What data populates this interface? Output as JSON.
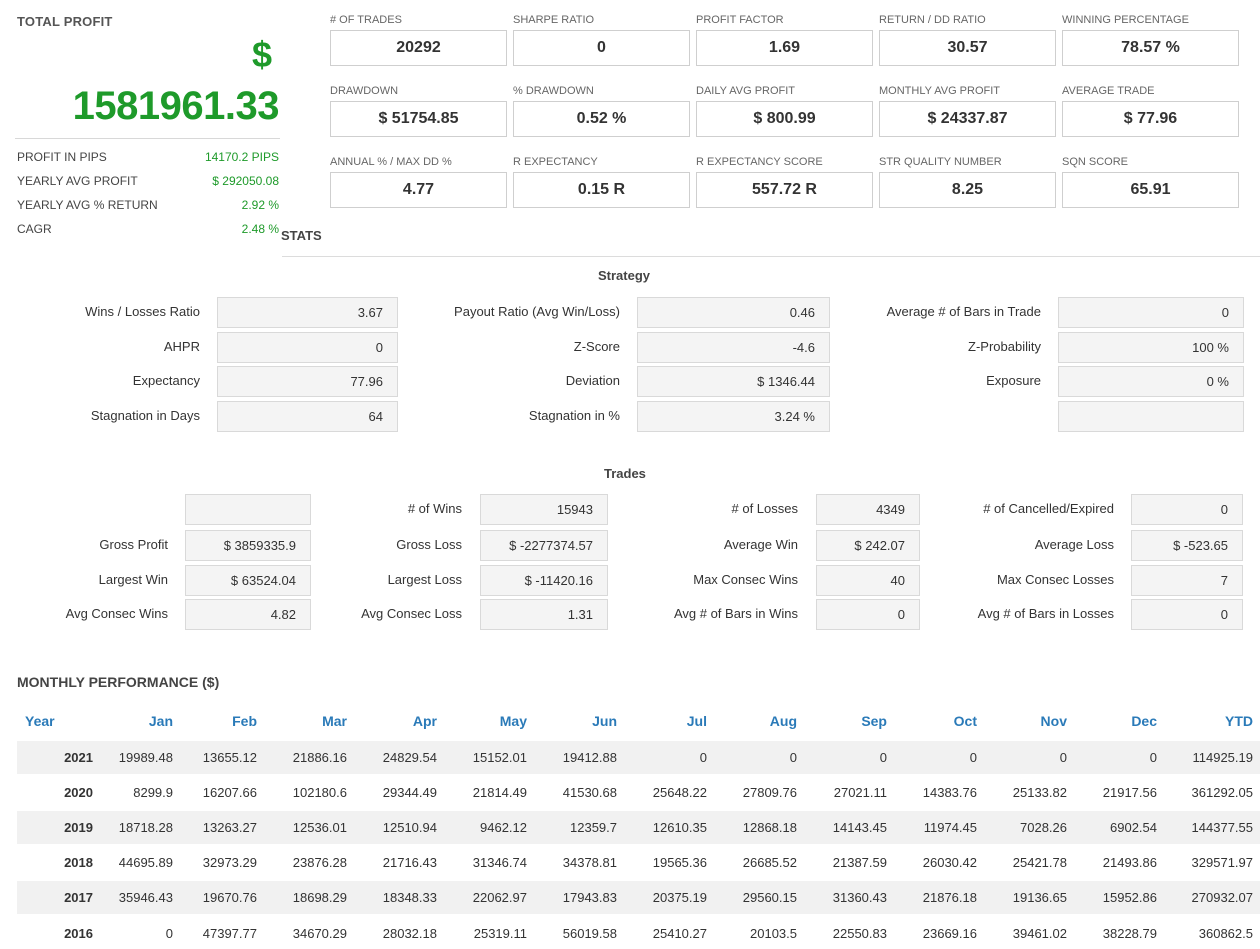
{
  "total_profit": {
    "title": "TOTAL PROFIT",
    "currency": "$",
    "value": "1581961.33",
    "stats": [
      {
        "label": "PROFIT IN PIPS",
        "value": "14170.2 PIPS"
      },
      {
        "label": "YEARLY AVG PROFIT",
        "value": "$ 292050.08"
      },
      {
        "label": "YEARLY AVG % RETURN",
        "value": "2.92 %"
      },
      {
        "label": "CAGR",
        "value": "2.48 %"
      }
    ]
  },
  "kpis": [
    {
      "label": "# OF TRADES",
      "value": "20292"
    },
    {
      "label": "SHARPE RATIO",
      "value": "0"
    },
    {
      "label": "PROFIT FACTOR",
      "value": "1.69"
    },
    {
      "label": "RETURN / DD RATIO",
      "value": "30.57"
    },
    {
      "label": "WINNING PERCENTAGE",
      "value": "78.57 %"
    },
    {
      "label": "DRAWDOWN",
      "value": "$ 51754.85"
    },
    {
      "label": "% DRAWDOWN",
      "value": "0.52 %"
    },
    {
      "label": "DAILY AVG PROFIT",
      "value": "$ 800.99"
    },
    {
      "label": "MONTHLY AVG PROFIT",
      "value": "$ 24337.87"
    },
    {
      "label": "AVERAGE TRADE",
      "value": "$ 77.96"
    },
    {
      "label": "ANNUAL % / MAX DD %",
      "value": "4.77"
    },
    {
      "label": "R EXPECTANCY",
      "value": "0.15 R"
    },
    {
      "label": "R EXPECTANCY SCORE",
      "value": "557.72 R"
    },
    {
      "label": "STR QUALITY NUMBER",
      "value": "8.25"
    },
    {
      "label": "SQN SCORE",
      "value": "65.91"
    }
  ],
  "stats_title": "STATS",
  "strategy": {
    "title": "Strategy",
    "rows": [
      [
        {
          "label": "Wins / Losses Ratio",
          "value": "3.67"
        },
        {
          "label": "Payout Ratio (Avg Win/Loss)",
          "value": "0.46"
        },
        {
          "label": "Average # of Bars in Trade",
          "value": "0"
        }
      ],
      [
        {
          "label": "AHPR",
          "value": "0"
        },
        {
          "label": "Z-Score",
          "value": "-4.6"
        },
        {
          "label": "Z-Probability",
          "value": "100 %"
        }
      ],
      [
        {
          "label": "Expectancy",
          "value": "77.96"
        },
        {
          "label": "Deviation",
          "value": "$ 1346.44"
        },
        {
          "label": "Exposure",
          "value": "0 %"
        }
      ],
      [
        {
          "label": "Stagnation in Days",
          "value": "64"
        },
        {
          "label": "Stagnation in %",
          "value": "3.24 %"
        },
        {
          "label": "",
          "value": ""
        }
      ]
    ]
  },
  "trades": {
    "title": "Trades",
    "rows": [
      [
        {
          "label": "",
          "value": ""
        },
        {
          "label": "# of Wins",
          "value": "15943"
        },
        {
          "label": "# of Losses",
          "value": "4349"
        },
        {
          "label": "# of Cancelled/Expired",
          "value": "0"
        }
      ],
      [
        {
          "label": "Gross Profit",
          "value": "$ 3859335.9"
        },
        {
          "label": "Gross Loss",
          "value": "$ -2277374.57"
        },
        {
          "label": "Average Win",
          "value": "$ 242.07"
        },
        {
          "label": "Average Loss",
          "value": "$ -523.65"
        }
      ],
      [
        {
          "label": "Largest Win",
          "value": "$ 63524.04"
        },
        {
          "label": "Largest Loss",
          "value": "$ -11420.16"
        },
        {
          "label": "Max Consec Wins",
          "value": "40"
        },
        {
          "label": "Max Consec Losses",
          "value": "7"
        }
      ],
      [
        {
          "label": "Avg Consec Wins",
          "value": "4.82"
        },
        {
          "label": "Avg Consec Loss",
          "value": "1.31"
        },
        {
          "label": "Avg # of Bars in Wins",
          "value": "0"
        },
        {
          "label": "Avg # of Bars in Losses",
          "value": "0"
        }
      ]
    ]
  },
  "monthly": {
    "title": "MONTHLY PERFORMANCE ($)",
    "headers": [
      "Year",
      "Jan",
      "Feb",
      "Mar",
      "Apr",
      "May",
      "Jun",
      "Jul",
      "Aug",
      "Sep",
      "Oct",
      "Nov",
      "Dec",
      "YTD"
    ],
    "rows": [
      [
        "2021",
        "19989.48",
        "13655.12",
        "21886.16",
        "24829.54",
        "15152.01",
        "19412.88",
        "0",
        "0",
        "0",
        "0",
        "0",
        "0",
        "114925.19"
      ],
      [
        "2020",
        "8299.9",
        "16207.66",
        "102180.6",
        "29344.49",
        "21814.49",
        "41530.68",
        "25648.22",
        "27809.76",
        "27021.11",
        "14383.76",
        "25133.82",
        "21917.56",
        "361292.05"
      ],
      [
        "2019",
        "18718.28",
        "13263.27",
        "12536.01",
        "12510.94",
        "9462.12",
        "12359.7",
        "12610.35",
        "12868.18",
        "14143.45",
        "11974.45",
        "7028.26",
        "6902.54",
        "144377.55"
      ],
      [
        "2018",
        "44695.89",
        "32973.29",
        "23876.28",
        "21716.43",
        "31346.74",
        "34378.81",
        "19565.36",
        "26685.52",
        "21387.59",
        "26030.42",
        "25421.78",
        "21493.86",
        "329571.97"
      ],
      [
        "2017",
        "35946.43",
        "19670.76",
        "18698.29",
        "18348.33",
        "22062.97",
        "17943.83",
        "20375.19",
        "29560.15",
        "31360.43",
        "21876.18",
        "19136.65",
        "15952.86",
        "270932.07"
      ],
      [
        "2016",
        "0",
        "47397.77",
        "34670.29",
        "28032.18",
        "25319.11",
        "56019.58",
        "25410.27",
        "20103.5",
        "22550.83",
        "23669.16",
        "39461.02",
        "38228.79",
        "360862.5"
      ]
    ]
  }
}
